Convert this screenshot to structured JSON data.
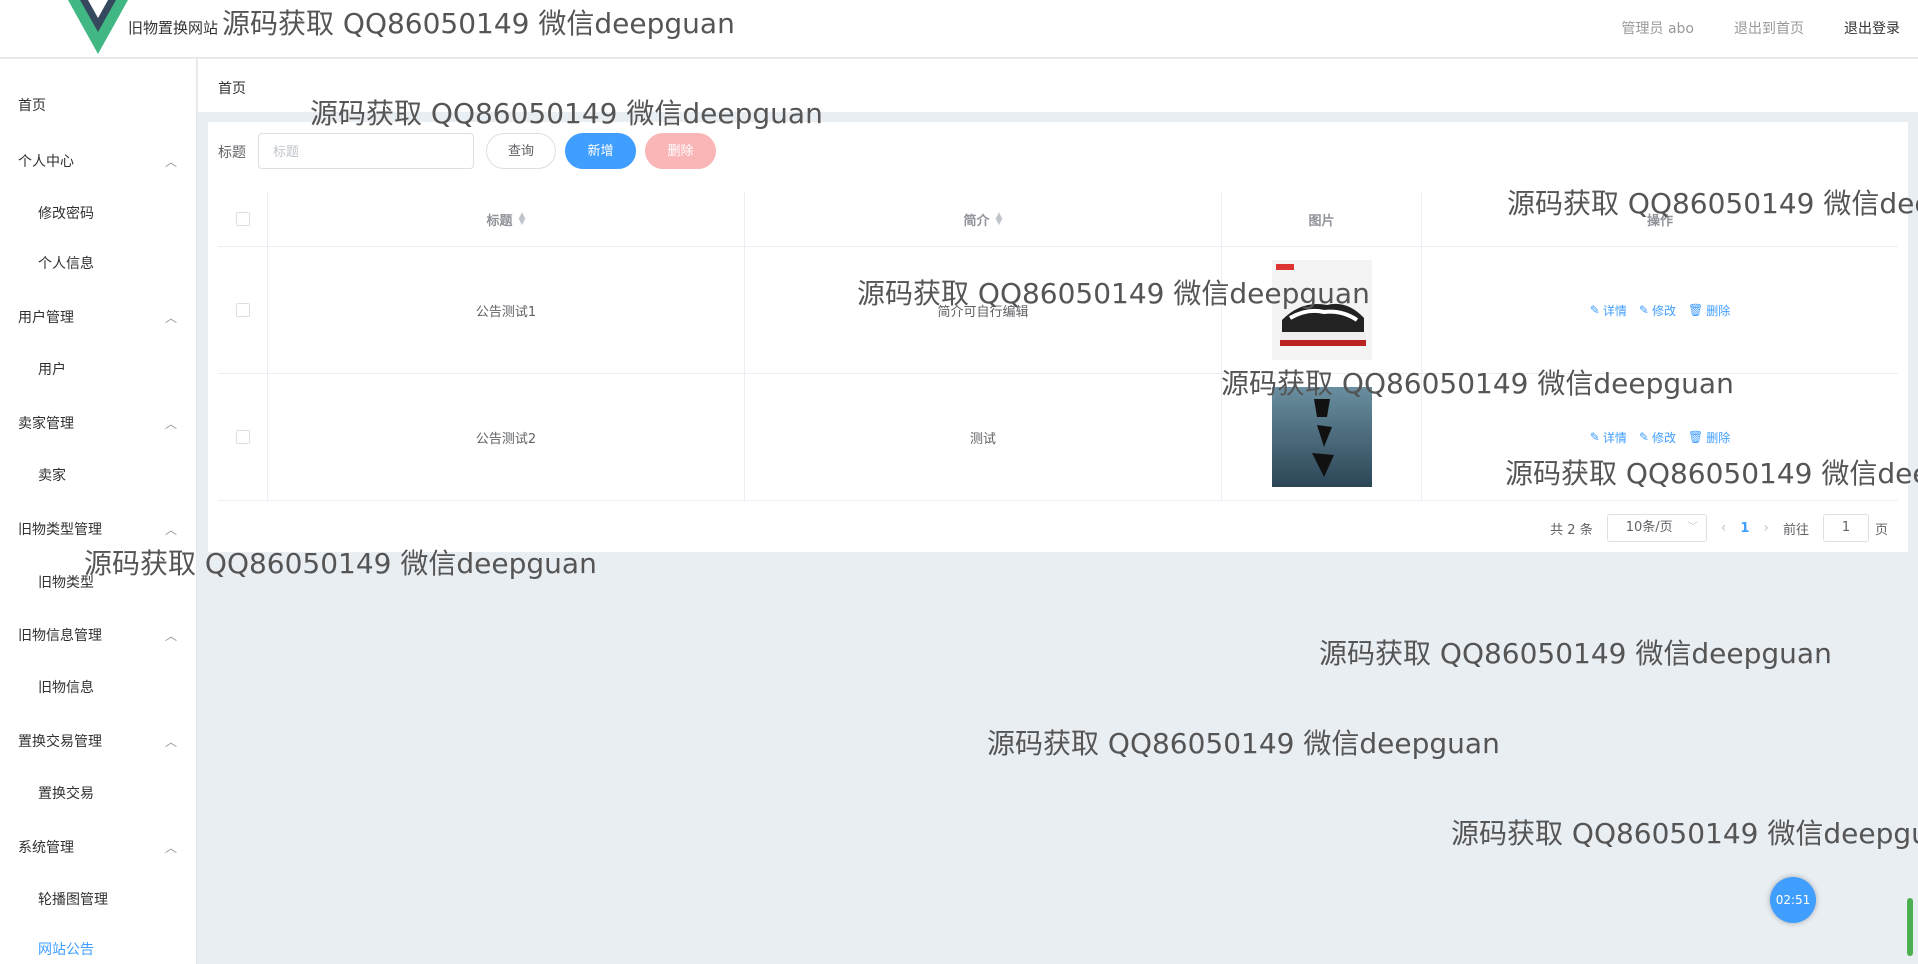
{
  "header": {
    "site_title": "旧物置换网站",
    "admin_label": "管理员 abo",
    "back_home": "退出到首页",
    "logout": "退出登录"
  },
  "sidebar": {
    "items": [
      {
        "label": "首页",
        "type": "top"
      },
      {
        "label": "个人中心",
        "type": "group"
      },
      {
        "label": "修改密码",
        "type": "sub"
      },
      {
        "label": "个人信息",
        "type": "sub"
      },
      {
        "label": "用户管理",
        "type": "group"
      },
      {
        "label": "用户",
        "type": "sub"
      },
      {
        "label": "卖家管理",
        "type": "group"
      },
      {
        "label": "卖家",
        "type": "sub"
      },
      {
        "label": "旧物类型管理",
        "type": "group"
      },
      {
        "label": "旧物类型",
        "type": "sub"
      },
      {
        "label": "旧物信息管理",
        "type": "group"
      },
      {
        "label": "旧物信息",
        "type": "sub"
      },
      {
        "label": "置换交易管理",
        "type": "group"
      },
      {
        "label": "置换交易",
        "type": "sub"
      },
      {
        "label": "系统管理",
        "type": "group"
      },
      {
        "label": "轮播图管理",
        "type": "sub"
      },
      {
        "label": "网站公告",
        "type": "sub",
        "active": true
      }
    ]
  },
  "breadcrumb": "首页",
  "search": {
    "label": "标题",
    "placeholder": "标题",
    "query_btn": "查询",
    "add_btn": "新增",
    "delete_btn": "删除"
  },
  "table": {
    "headers": {
      "title": "标题",
      "desc": "简介",
      "image": "图片",
      "ops": "操作"
    },
    "rows": [
      {
        "title": "公告测试1",
        "desc": "简介可自行编辑"
      },
      {
        "title": "公告测试2",
        "desc": "测试"
      }
    ],
    "ops": {
      "detail": "详情",
      "edit": "修改",
      "delete": "删除"
    }
  },
  "pagination": {
    "total": "共 2 条",
    "page_size": "10条/页",
    "current": "1",
    "goto_prefix": "前往",
    "goto_value": "1",
    "goto_suffix": "页"
  },
  "watermark": "源码获取 QQ86050149 微信deepguan",
  "timer": "02:51",
  "colors": {
    "accent": "#409eff",
    "danger_light": "#fab6b6",
    "bg": "#e9eef3"
  }
}
